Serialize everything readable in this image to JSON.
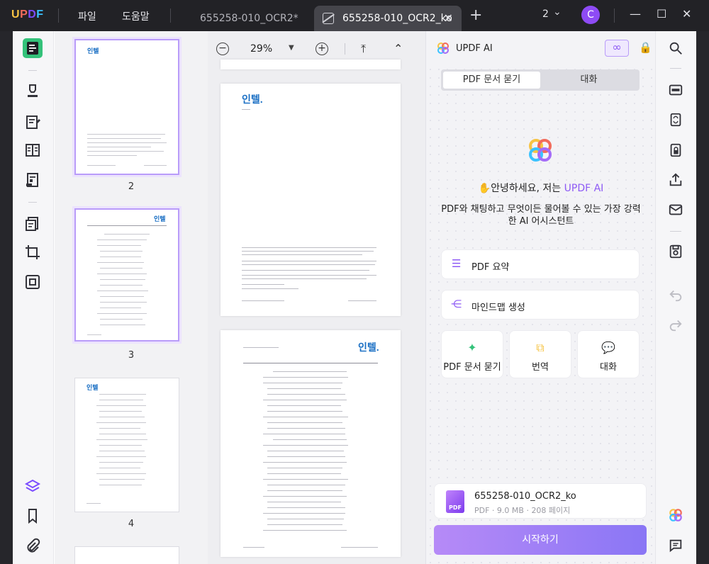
{
  "titlebar": {
    "logo": "UPDF",
    "menu": [
      "파일",
      "도움말"
    ],
    "tabs": [
      {
        "label": "655258-010_OCR2*",
        "active": false
      },
      {
        "label": "655258-010_OCR2_ko",
        "active": true
      }
    ],
    "window_count": "2",
    "avatar_initial": "C"
  },
  "thumbnails": [
    {
      "page": "2",
      "brand": "인텔",
      "selected": true
    },
    {
      "page": "3",
      "brand": "인텔",
      "selected": true
    },
    {
      "page": "4",
      "brand": "인텔",
      "selected": false
    }
  ],
  "doc_toolbar": {
    "zoom": "29%"
  },
  "pages": {
    "page2_brand": "인텔.",
    "page3_brand": "인텔."
  },
  "ai_panel": {
    "title": "UPDF AI",
    "mode_tabs": [
      "PDF 문서 묻기",
      "대화"
    ],
    "greeting_prefix": "안녕하세요, 저는 ",
    "greeting_brand": "UPDF AI",
    "description": "PDF와 채팅하고 무엇이든 물어볼 수 있는 가장 강력한 AI 어시스턴트",
    "actions_wide": [
      "PDF 요약",
      "마인드맵 생성"
    ],
    "actions_small": [
      "PDF 문서 묻기",
      "번역",
      "대화"
    ],
    "file": {
      "name": "655258-010_OCR2_ko",
      "meta": "PDF · 9.0 MB · 208 페이지"
    },
    "start_button": "시작하기"
  },
  "colors": {
    "accent": "#8e5af5",
    "brand_blue": "#1a6fc4",
    "active_tool": "#34c27a"
  }
}
